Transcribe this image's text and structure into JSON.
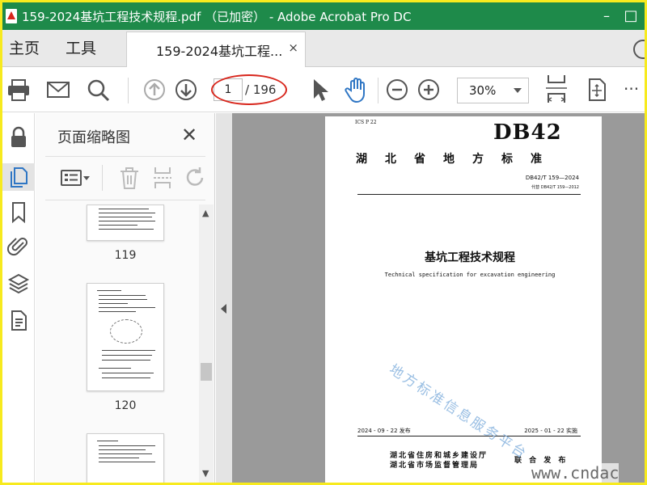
{
  "window": {
    "title": "159-2024基坑工程技术规程.pdf （已加密） - Adobe Acrobat Pro DC",
    "minimize": "–",
    "maximize": "□"
  },
  "tabs": {
    "home": "主页",
    "tools": "工具",
    "document": "159-2024基坑工程...",
    "close": "×"
  },
  "toolbar": {
    "page_current": "1",
    "page_total": "/ 196",
    "zoom": "30%",
    "more": "···"
  },
  "panel": {
    "title": "页面缩略图",
    "close": "✕",
    "thumbnails": [
      {
        "label": "119"
      },
      {
        "label": "120"
      }
    ]
  },
  "document": {
    "ics": "ICS  P 22",
    "code": "DB42",
    "standard_name": "湖北省地方标准",
    "standard_number": "DB42/T 159—2024",
    "replaces": "代替 DB42/T 159—2012",
    "title_cn": "基坑工程技术规程",
    "title_en": "Technical specification for excavation engineering",
    "issue_date": "2024 - 09 - 22 发布",
    "implement_date": "2025 - 01 - 22 实施",
    "publisher_1": "湖北省住房和城乡建设厅",
    "publisher_2": "湖北省市场监督管理局",
    "joint_issue": "联 合 发 布",
    "watermark": "地方标准信息服务平台"
  },
  "site_mark": "www.cndac",
  "colors": {
    "title_bar": "#1e8a4a",
    "frame": "#f7ea1e",
    "highlight": "#d8261c"
  }
}
